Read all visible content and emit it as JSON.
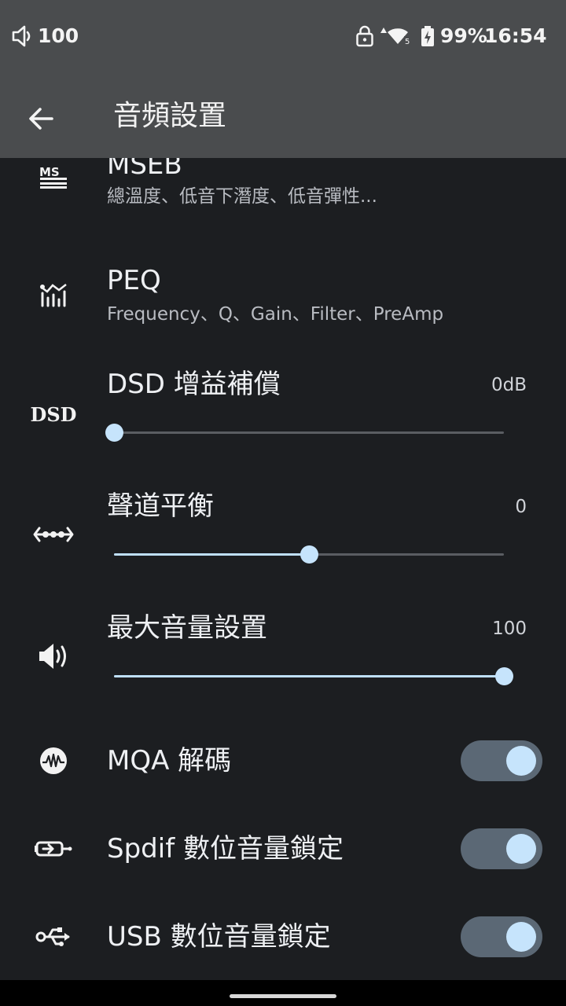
{
  "status_bar": {
    "volume_level": "100",
    "battery_percent": "99%",
    "time": "16:54",
    "icons": [
      "volume-icon",
      "lock-icon",
      "wifi-icon",
      "battery-charging-icon"
    ]
  },
  "app_bar": {
    "title": "音頻設置",
    "back_icon": "arrow-left-icon"
  },
  "settings": {
    "mseb": {
      "title": "MSEB",
      "summary": "總溫度、低音下潛度、低音彈性...",
      "icon": "mseb-icon"
    },
    "peq": {
      "title": "PEQ",
      "summary": "Frequency、Q、Gain、Filter、PreAmp",
      "icon": "peq-equalizer-icon"
    },
    "dsd_gain": {
      "title": "DSD 增益補償",
      "value": "0dB",
      "fraction": 0.0,
      "icon": "dsd-icon"
    },
    "channel_balance": {
      "title": "聲道平衡",
      "value": "0",
      "fraction": 0.5,
      "icon": "balance-icon"
    },
    "max_volume": {
      "title": "最大音量設置",
      "value": "100",
      "fraction": 1.0,
      "icon": "speaker-icon"
    },
    "mqa": {
      "title": "MQA 解碼",
      "enabled": true,
      "icon": "mqa-icon"
    },
    "spdif_lock": {
      "title": "Spdif 數位音量鎖定",
      "enabled": true,
      "icon": "spdif-icon"
    },
    "usb_lock": {
      "title": "USB 數位音量鎖定",
      "enabled": true,
      "icon": "usb-icon"
    }
  },
  "colors": {
    "background": "#1c1e21",
    "app_bar": "#4a4c4e",
    "accent": "#c6e4fc",
    "switch_track": "#5b6875"
  }
}
